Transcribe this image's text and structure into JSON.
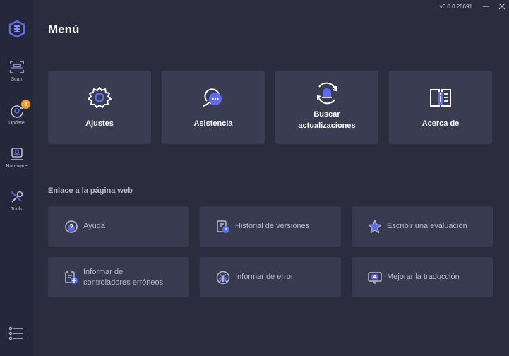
{
  "app": {
    "version": "v6.0.0.25691"
  },
  "sidebar": {
    "items": [
      {
        "label": "Scan",
        "icon": "scan-icon"
      },
      {
        "label": "Update",
        "icon": "update-icon",
        "badge": "4"
      },
      {
        "label": "Hardware",
        "icon": "hardware-icon"
      },
      {
        "label": "Tools",
        "icon": "tools-icon"
      }
    ]
  },
  "page": {
    "title": "Menú"
  },
  "cards": [
    {
      "label": "Ajustes",
      "icon": "gear-icon"
    },
    {
      "label": "Asistencia",
      "icon": "chat-icon"
    },
    {
      "label_line1": "Buscar",
      "label_line2": "actualizaciones",
      "icon": "refresh-bell-icon"
    },
    {
      "label": "Acerca de",
      "icon": "info-book-icon"
    }
  ],
  "links_section": {
    "title": "Enlace a la página web",
    "links": [
      {
        "label": "Ayuda",
        "icon": "help-icon"
      },
      {
        "label": "Historial de versiones",
        "icon": "history-icon"
      },
      {
        "label": "Escribir una evaluación",
        "icon": "star-icon"
      },
      {
        "label_line1": "Informar de",
        "label_line2": "controladores erróneos",
        "icon": "report-driver-icon"
      },
      {
        "label": "Informar de error",
        "icon": "bug-icon"
      },
      {
        "label": "Mejorar la traducción",
        "icon": "translate-icon"
      }
    ]
  },
  "colors": {
    "background": "#2b2d3e",
    "sidebar": "#25273a",
    "card": "#3a3d52",
    "accent": "#5b6cf0",
    "badge": "#f39a2c"
  }
}
